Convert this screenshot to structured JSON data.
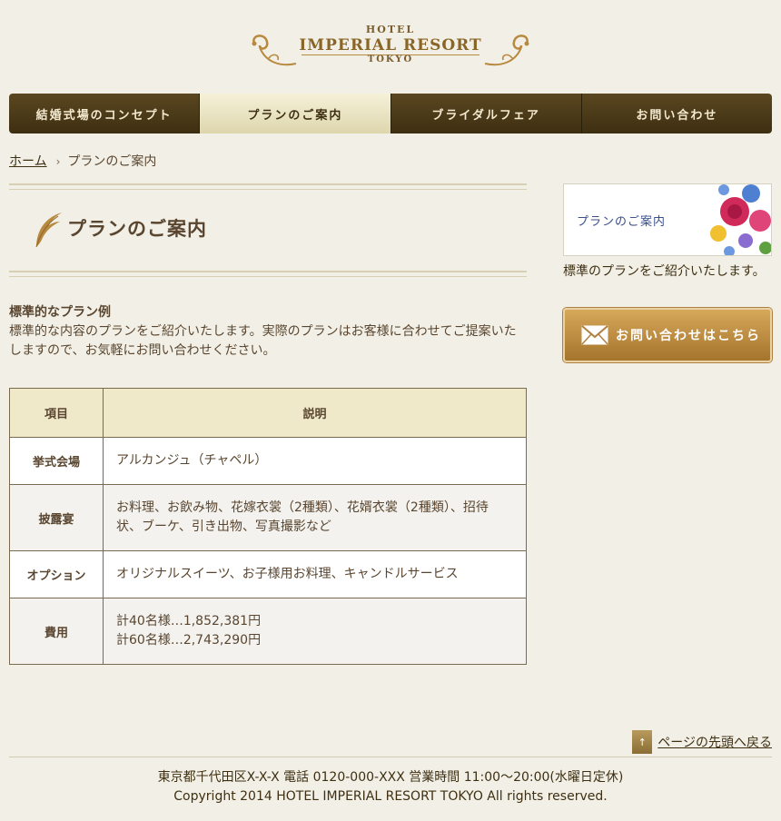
{
  "logo": {
    "top": "HOTEL",
    "name": "IMPERIAL RESORT",
    "city": "TOKYO"
  },
  "nav": {
    "items": [
      {
        "label": "結婚式場のコンセプト",
        "active": false
      },
      {
        "label": "プランのご案内",
        "active": true
      },
      {
        "label": "ブライダルフェア",
        "active": false
      },
      {
        "label": "お問い合わせ",
        "active": false
      }
    ]
  },
  "breadcrumb": {
    "home": "ホーム",
    "separator": "›",
    "current": "プランのご案内"
  },
  "page": {
    "title": "プランのご案内"
  },
  "intro": {
    "heading": "標準的なプラン例",
    "body": "標準的な内容のプランをご紹介いたします。実際のプランはお客様に合わせてご提案いたしますので、お気軽にお問い合わせください。"
  },
  "table": {
    "headers": [
      "項目",
      "説明"
    ],
    "rows": [
      {
        "item": "挙式会場",
        "desc": [
          "アルカンジュ（チャペル）"
        ]
      },
      {
        "item": "披露宴",
        "desc": [
          "お料理、お飲み物、花嫁衣裳（2種類）、花婿衣裳（2種類）、招待状、ブーケ、引き出物、写真撮影など"
        ]
      },
      {
        "item": "オプション",
        "desc": [
          "オリジナルスイーツ、お子様用お料理、キャンドルサービス"
        ]
      },
      {
        "item": "費用",
        "desc": [
          "計40名様…1,852,381円",
          "計60名様…2,743,290円"
        ]
      }
    ]
  },
  "sidebar": {
    "banner_text": "プランのご案内",
    "banner_caption": "標準のプランをご紹介いたします。",
    "contact_button": "お問い合わせはこちら"
  },
  "footer": {
    "to_top": "ページの先頭へ戻る",
    "to_top_icon": "↑",
    "address": "東京都千代田区X-X-X 電話 0120-000-XXX 営業時間 11:00～20:00(水曜日定休)",
    "copyright": "Copyright 2014 HOTEL IMPERIAL RESORT TOKYO All rights reserved."
  },
  "colors": {
    "background": "#f2f0e6",
    "nav_dark": "#4a3a18",
    "nav_active": "#e8e2c0",
    "table_header": "#efe8c9",
    "accent_gold": "#b8893f"
  }
}
